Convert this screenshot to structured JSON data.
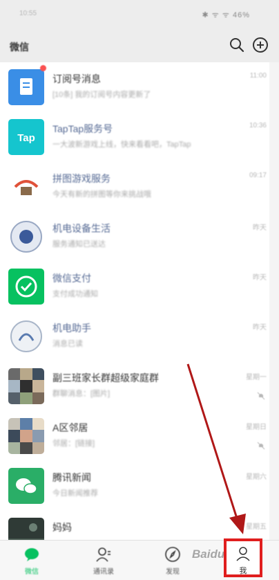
{
  "status_bar": {
    "time": "10:55",
    "icons": "✱ ᯤ ᯤ 46%"
  },
  "header": {
    "title": "微信"
  },
  "colors": {
    "wechat_green": "#07c160",
    "link_blue": "#576b95",
    "annotation_red": "#e01e1e",
    "badge_red": "#fa5151"
  },
  "chats": [
    {
      "name": "订阅号消息",
      "preview": "[10条] 我的订阅号内容更新了",
      "time": "11:00",
      "muted": false,
      "badge": true,
      "name_color": "#333333"
    },
    {
      "name": "TapTap服务号",
      "preview": "一大波新游戏上线，快来看看吧，TapTap",
      "time": "10:36",
      "muted": false,
      "badge": false,
      "name_color": "#576b95"
    },
    {
      "name": "拼图游戏服务",
      "preview": "今天有新的拼图等你来挑战哦",
      "time": "09:17",
      "muted": false,
      "badge": false,
      "name_color": "#576b95"
    },
    {
      "name": "机电设备生活",
      "preview": "服务通知已送达",
      "time": "昨天",
      "muted": false,
      "badge": false,
      "name_color": "#576b95"
    },
    {
      "name": "微信支付",
      "preview": "支付成功通知",
      "time": "昨天",
      "muted": false,
      "badge": false,
      "name_color": "#576b95"
    },
    {
      "name": "机电助手",
      "preview": "消息已读",
      "time": "昨天",
      "muted": false,
      "badge": false,
      "name_color": "#576b95"
    },
    {
      "name": "副三班家长群超级家庭群",
      "preview": "群聊消息：[图片]",
      "time": "星期一",
      "muted": true,
      "badge": false,
      "name_color": "#333333"
    },
    {
      "name": "A区邻居",
      "preview": "邻居：[链接]",
      "time": "星期日",
      "muted": true,
      "badge": false,
      "name_color": "#333333"
    },
    {
      "name": "腾讯新闻",
      "preview": "今日新闻推荐",
      "time": "星期六",
      "muted": false,
      "badge": false,
      "name_color": "#333333"
    },
    {
      "name": "妈妈",
      "preview": "",
      "time": "星期五",
      "muted": false,
      "badge": false,
      "name_color": "#333333"
    }
  ],
  "tabs": [
    {
      "label": "微信"
    },
    {
      "label": "通讯录"
    },
    {
      "label": "发现"
    },
    {
      "label": "我"
    }
  ],
  "watermark": "Baidu 经验"
}
